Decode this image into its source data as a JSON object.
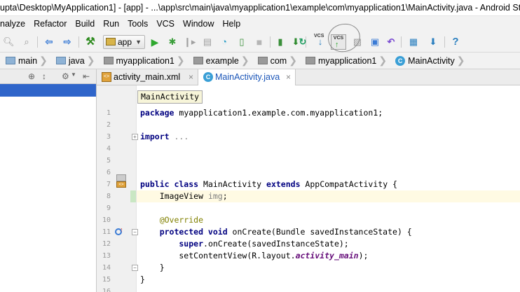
{
  "window": {
    "title": "upta\\Desktop\\MyApplication1] - [app] - ...\\app\\src\\main\\java\\myapplication1\\example\\com\\myapplication1\\MainActivity.java - Android Stu"
  },
  "menu": {
    "items": [
      "nalyze",
      "Refactor",
      "Build",
      "Run",
      "Tools",
      "VCS",
      "Window",
      "Help"
    ]
  },
  "toolbar": {
    "run_config": "app",
    "vcs_update_label": "VCS",
    "vcs_commit_label": "VCS",
    "icons": [
      "search-icon",
      "find-icon",
      "back-arrow-icon",
      "forward-arrow-icon",
      "make-hammer-icon",
      "run-icon",
      "debug-icon",
      "attach-icon",
      "coverage-icon",
      "profile-icon",
      "apply-changes-icon",
      "stop-icon",
      "avd-manager-icon",
      "sdk-manager-icon",
      "sync-icon",
      "vcs-update-icon",
      "vcs-commit-icon",
      "compare-icon",
      "history-icon",
      "revert-icon",
      "project-structure-icon",
      "sdk-download-icon",
      "help-icon"
    ]
  },
  "breadcrumb": {
    "items": [
      {
        "label": "main",
        "kind": "folder-blue"
      },
      {
        "label": "java",
        "kind": "folder-blue"
      },
      {
        "label": "myapplication1",
        "kind": "package"
      },
      {
        "label": "example",
        "kind": "package"
      },
      {
        "label": "com",
        "kind": "package"
      },
      {
        "label": "myapplication1",
        "kind": "package"
      },
      {
        "label": "MainActivity",
        "kind": "class"
      }
    ]
  },
  "tabs": [
    {
      "label": "activity_main.xml",
      "active": false
    },
    {
      "label": "MainActivity.java",
      "active": true
    }
  ],
  "editor": {
    "tooltip": "MainActivity",
    "lines": [
      {
        "n": "1"
      },
      {
        "n": "2"
      },
      {
        "n": "3"
      },
      {
        "n": "4"
      },
      {
        "n": "5"
      },
      {
        "n": "6"
      },
      {
        "n": "7"
      },
      {
        "n": "8"
      },
      {
        "n": "9"
      },
      {
        "n": "10"
      },
      {
        "n": "11"
      },
      {
        "n": "12"
      },
      {
        "n": "13"
      },
      {
        "n": "14"
      },
      {
        "n": "15"
      },
      {
        "n": "16"
      }
    ],
    "code": {
      "l1_kw": "package",
      "l1_rest": " myapplication1.example.com.myapplication1;",
      "l3_kw": "import",
      "l3_rest": " ...",
      "l7_kw1": "public class",
      "l7_mid": " MainActivity ",
      "l7_kw2": "extends",
      "l7_rest": " AppCompatActivity {",
      "l8_type": "    ImageView ",
      "l8_var": "img",
      "l8_end": ";",
      "l10_ann": "    @Override",
      "l11_kw": "    protected void",
      "l11_rest": " onCreate(Bundle savedInstanceState) {",
      "l12_kw": "        super",
      "l12_rest": ".onCreate(savedInstanceState);",
      "l13_a": "        setContentView(R.layout.",
      "l13_fld": "activity_main",
      "l13_b": ");",
      "l14": "    }",
      "l15": "}"
    }
  }
}
